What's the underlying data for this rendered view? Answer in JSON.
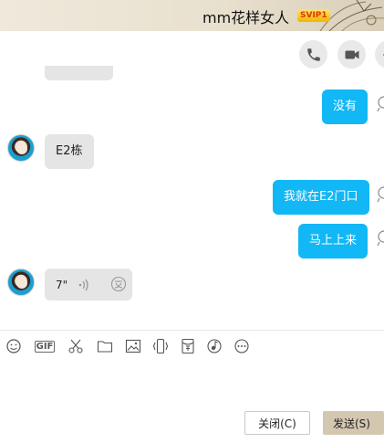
{
  "header": {
    "contact_name": "mm花样女人",
    "vip_badge": "SVIP1"
  },
  "toolbar": {
    "icons": [
      "phone-icon",
      "video-camera-icon",
      "more-icon"
    ]
  },
  "messages": [
    {
      "sender": "me",
      "text": "没有"
    },
    {
      "sender": "them",
      "text": "E2栋"
    },
    {
      "sender": "me",
      "text": "我就在E2门口"
    },
    {
      "sender": "me",
      "text": "马上上来"
    },
    {
      "sender": "them",
      "type": "voice",
      "duration": "7\""
    }
  ],
  "input_toolbar": {
    "icons": [
      "emoji-icon",
      "gif-icon",
      "scissors-icon",
      "folder-icon",
      "image-icon",
      "phone-shake-icon",
      "red-packet-icon",
      "music-icon",
      "more-icon"
    ],
    "gif_label": "GIF"
  },
  "buttons": {
    "close": "关闭(C)",
    "send": "发送(S)"
  },
  "colors": {
    "outgoing_bubble": "#12b7f5",
    "incoming_bubble": "#e5e5e5",
    "send_button": "#d3c7b0"
  }
}
